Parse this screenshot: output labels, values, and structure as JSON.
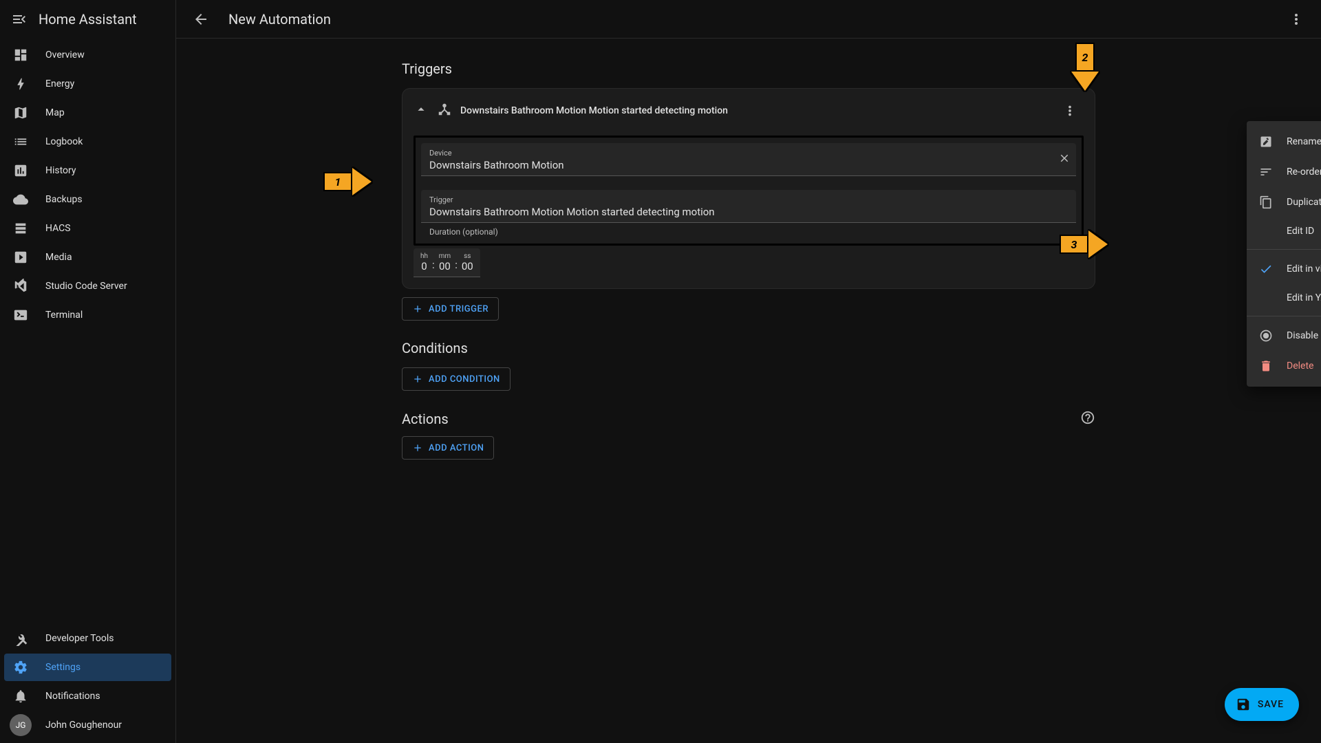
{
  "sidebar": {
    "title": "Home Assistant",
    "items": [
      {
        "label": "Overview"
      },
      {
        "label": "Energy"
      },
      {
        "label": "Map"
      },
      {
        "label": "Logbook"
      },
      {
        "label": "History"
      },
      {
        "label": "Backups"
      },
      {
        "label": "HACS"
      },
      {
        "label": "Media"
      },
      {
        "label": "Studio Code Server"
      },
      {
        "label": "Terminal"
      }
    ],
    "bottom": {
      "dev_tools": "Developer Tools",
      "settings": "Settings",
      "notifications": "Notifications",
      "user_initials": "JG",
      "user_name": "John Goughenour"
    }
  },
  "header": {
    "title": "New Automation"
  },
  "triggers": {
    "heading": "Triggers",
    "add": "Add Trigger",
    "card": {
      "title": "Downstairs Bathroom Motion Motion started detecting motion",
      "device_label": "Device",
      "device_value": "Downstairs Bathroom Motion",
      "trigger_label": "Trigger",
      "trigger_value": "Downstairs Bathroom Motion Motion started detecting motion",
      "duration_helper": "Duration (optional)",
      "hh_label": "hh",
      "hh_value": "0",
      "mm_label": "mm",
      "mm_value": "00",
      "ss_label": "ss",
      "ss_value": "00"
    }
  },
  "conditions": {
    "heading": "Conditions",
    "add": "Add Condition"
  },
  "actions": {
    "heading": "Actions",
    "add": "Add Action"
  },
  "menu": {
    "rename": "Rename",
    "reorder": "Re-order",
    "duplicate": "Duplicate",
    "edit_id": "Edit ID",
    "visual": "Edit in visual editor",
    "yaml": "Edit in YAML",
    "disable": "Disable",
    "delete": "Delete"
  },
  "fab": {
    "label": "SAVE"
  },
  "annotations": {
    "a1": "1",
    "a2": "2",
    "a3": "3"
  }
}
